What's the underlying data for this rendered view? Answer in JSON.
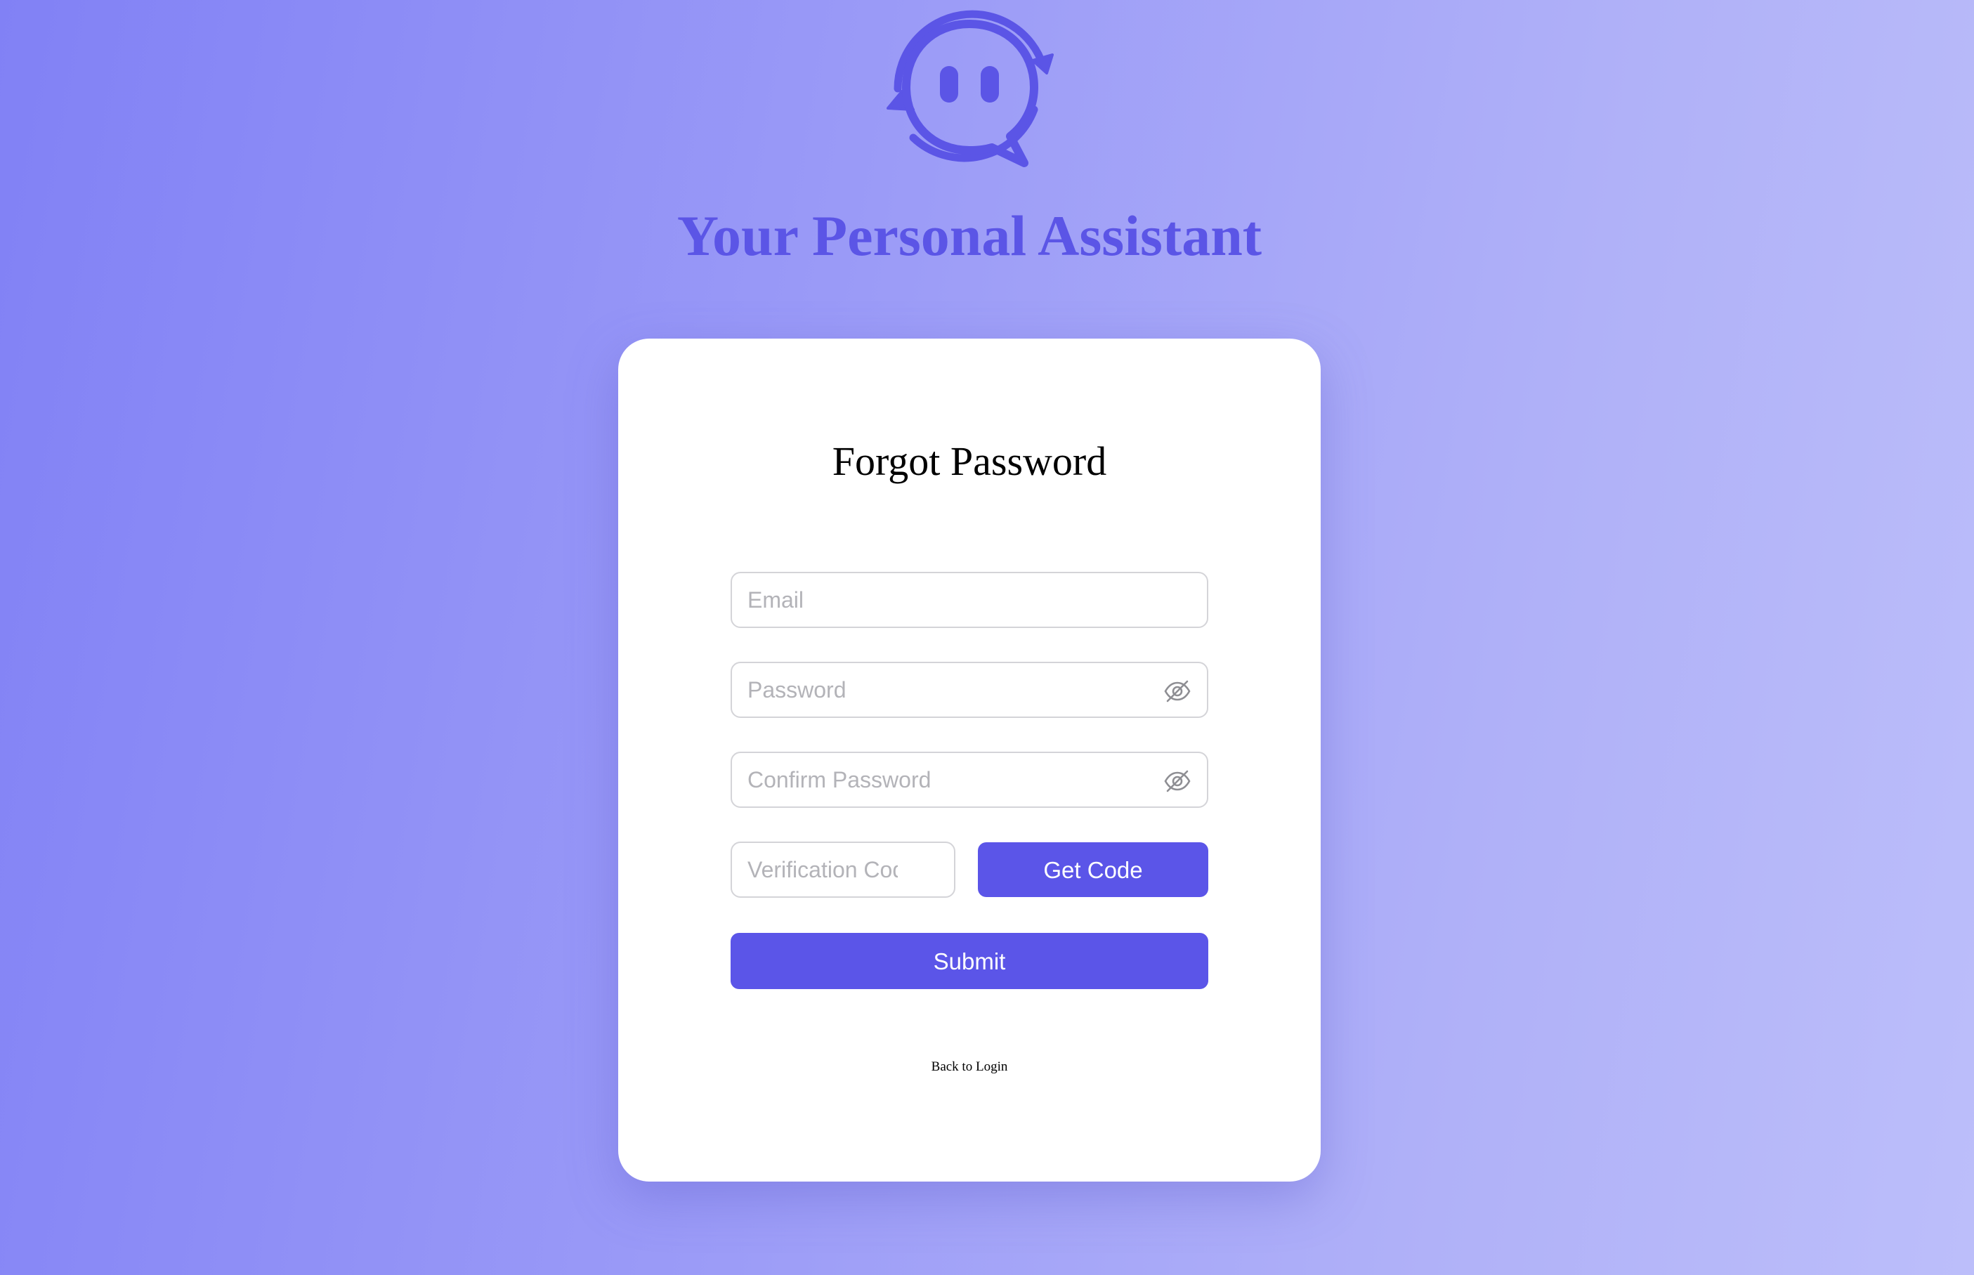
{
  "app": {
    "title": "Your Personal Assistant",
    "logo_icon": "chat-bot-face-icon"
  },
  "form": {
    "title": "Forgot Password",
    "email": {
      "placeholder": "Email",
      "value": ""
    },
    "password": {
      "placeholder": "Password",
      "value": "",
      "toggle_icon": "eye-off-icon"
    },
    "confirm_password": {
      "placeholder": "Confirm Password",
      "value": "",
      "toggle_icon": "eye-off-icon"
    },
    "verification_code": {
      "placeholder": "Verification Code",
      "value": ""
    },
    "get_code_label": "Get Code",
    "submit_label": "Submit",
    "back_link": "Back to Login"
  },
  "colors": {
    "accent": "#5b55e8",
    "title_color": "#5b55e6",
    "background_start": "#8181f5",
    "background_end": "#bcbefa",
    "card_background": "#ffffff",
    "input_border": "#d4d4d8",
    "placeholder": "#b3b3b8"
  }
}
